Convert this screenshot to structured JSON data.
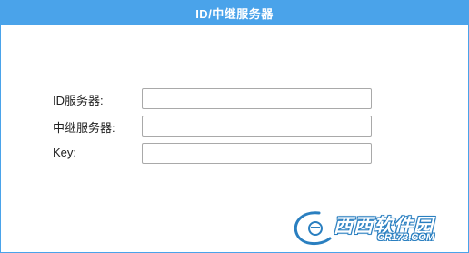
{
  "window": {
    "title": "ID/中继服务器"
  },
  "form": {
    "fields": [
      {
        "label": "ID服务器:",
        "value": ""
      },
      {
        "label": "中继服务器:",
        "value": ""
      },
      {
        "label": "Key:",
        "value": ""
      }
    ]
  },
  "watermark": {
    "text": "西西软件园",
    "site": "CR173.COM"
  },
  "colors": {
    "accent": "#4aa3ea",
    "border": "#a9a9a9"
  }
}
